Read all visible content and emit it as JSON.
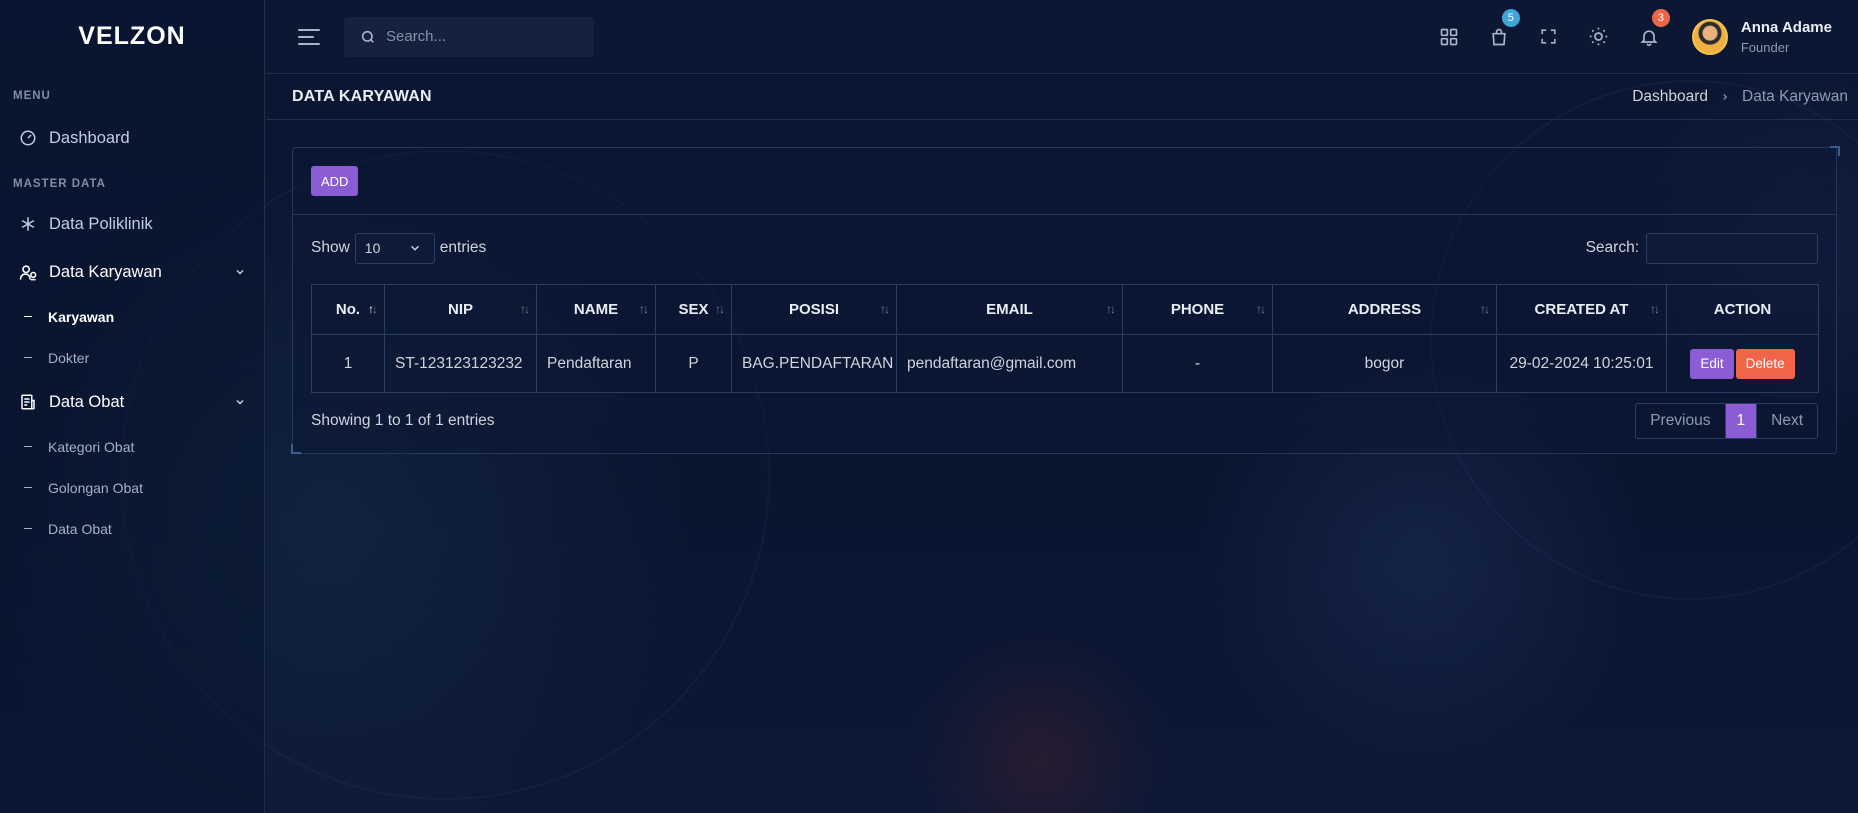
{
  "brand": {
    "logo_text": "VELZON"
  },
  "sidebar": {
    "menu_title": "MENU",
    "master_title": "MASTER DATA",
    "items": [
      {
        "label": "Dashboard",
        "icon": "speedometer-icon"
      },
      {
        "label": "Data Poliklinik",
        "icon": "asterisk-icon"
      },
      {
        "label": "Data Karyawan",
        "icon": "users-icon",
        "subitems": [
          "Karyawan",
          "Dokter"
        ]
      },
      {
        "label": "Data Obat",
        "icon": "file-list-icon",
        "subitems": [
          "Kategori Obat",
          "Golongan Obat",
          "Data Obat"
        ]
      }
    ]
  },
  "topbar": {
    "search_placeholder": "Search...",
    "cart_badge": "5",
    "notif_badge": "3",
    "user_name": "Anna Adame",
    "user_role": "Founder"
  },
  "page": {
    "title": "DATA KARYAWAN",
    "breadcrumb": [
      "Dashboard",
      "Data Karyawan"
    ]
  },
  "card": {
    "add_label": "ADD",
    "show_label": "Show",
    "entries_value": "10",
    "entries_label": "entries",
    "search_label": "Search:",
    "columns": [
      "No.",
      "NIP",
      "NAME",
      "SEX",
      "POSISI",
      "EMAIL",
      "PHONE",
      "ADDRESS",
      "CREATED AT",
      "ACTION"
    ],
    "rows": [
      {
        "no": "1",
        "nip": "ST-123123123232",
        "name": "Pendaftaran",
        "sex": "P",
        "posisi": "BAG.PENDAFTARAN",
        "email": "pendaftaran@gmail.com",
        "phone": "-",
        "address": "bogor",
        "created_at": "29-02-2024 10:25:01",
        "edit_label": "Edit",
        "delete_label": "Delete"
      }
    ],
    "info": "Showing 1 to 1 of 1 entries",
    "pagination": {
      "prev": "Previous",
      "current": "1",
      "next": "Next"
    }
  },
  "colors": {
    "accent": "#8b5cd3",
    "danger": "#f06548",
    "info": "#3da5d9",
    "background": "#0a1530"
  }
}
